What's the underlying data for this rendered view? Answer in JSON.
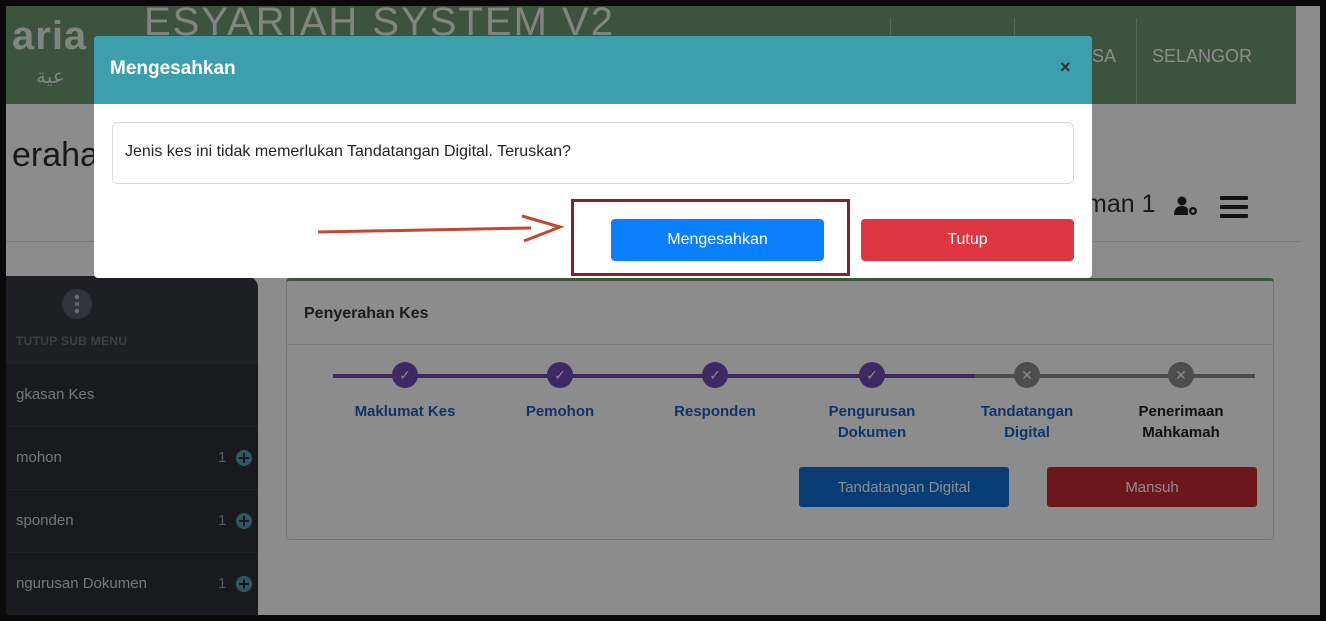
{
  "app": {
    "logo_text": "aria",
    "logo_arabic": "عية",
    "system_title": "ESYARIAH SYSTEM V2"
  },
  "header_nav": {
    "items": [
      {
        "label": "SA"
      },
      {
        "label": "SELANGOR"
      }
    ]
  },
  "page": {
    "title": "eraha",
    "user_text": "man 1"
  },
  "sidebar": {
    "submenu_label": "TUTUP SUB MENU",
    "items": [
      {
        "label": "gkasan Kes",
        "count": ""
      },
      {
        "label": "mohon",
        "count": "1"
      },
      {
        "label": "sponden",
        "count": "1"
      },
      {
        "label": "ngurusan Dokumen",
        "count": "1"
      }
    ]
  },
  "card": {
    "title": "Penyerahan Kes",
    "steps": [
      {
        "label": "Maklumat Kes",
        "status": "done"
      },
      {
        "label": "Pemohon",
        "status": "done"
      },
      {
        "label": "Responden",
        "status": "done"
      },
      {
        "label": "Pengurusan Dokumen",
        "status": "done"
      },
      {
        "label": "Tandatangan Digital",
        "status": "pending"
      },
      {
        "label": "Penerimaan Mahkamah",
        "status": "pending"
      }
    ],
    "sign_button": "Tandatangan Digital",
    "cancel_button": "Mansuh"
  },
  "modal": {
    "title": "Mengesahkan",
    "close_symbol": "×",
    "message": "Jenis kes ini tidak memerlukan Tandatangan Digital. Teruskan?",
    "confirm_label": "Mengesahkan",
    "close_label": "Tutup"
  },
  "colors": {
    "header_green": "#6e9a72",
    "modal_header": "#3b9fad",
    "step_done": "#6f4bb5",
    "step_pending": "#8c8c8c",
    "primary_blue": "#0b80ff",
    "danger_red": "#dd3640",
    "annotation": "#7c2630"
  }
}
